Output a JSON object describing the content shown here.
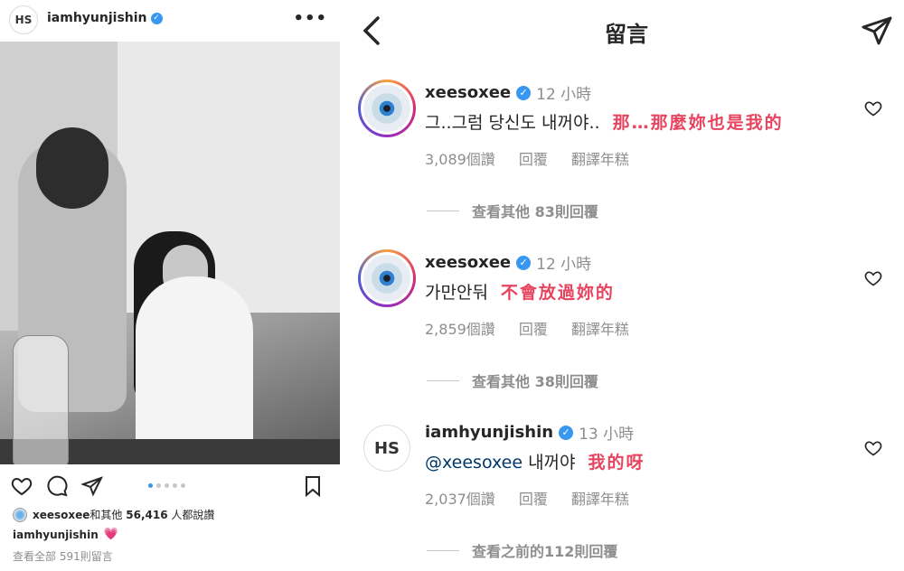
{
  "post": {
    "avatar_initials": "HS",
    "username": "iamhyunjishin",
    "more_label": "•••",
    "carousel_dots": 5,
    "likes_user": "xeesoxee",
    "likes_text": "和其他",
    "likes_count": "56,416",
    "likes_suffix": "人都說讚",
    "caption_user": "iamhyunjishin",
    "caption_emoji": "💗",
    "view_all_comments": "查看全部 591則留言"
  },
  "header": {
    "title": "留言"
  },
  "comments": [
    {
      "username": "xeesoxee",
      "time": "12 小時",
      "text": "그..그럼 당신도 내꺼야..",
      "translation": "那…那麼妳也是我的",
      "likes": "3,089個讚",
      "reply": "回覆",
      "translate": "翻譯年糕",
      "more_replies": "查看其他 83則回覆"
    },
    {
      "username": "xeesoxee",
      "time": "12 小時",
      "text": "가만안둬",
      "translation": "不會放過妳的",
      "likes": "2,859個讚",
      "reply": "回覆",
      "translate": "翻譯年糕",
      "more_replies": "查看其他 38則回覆"
    },
    {
      "avatar_initials": "HS",
      "username": "iamhyunjishin",
      "time": "13 小時",
      "mention": "@xeesoxee",
      "text": "내꺼야",
      "translation": "我的呀",
      "likes": "2,037個讚",
      "reply": "回覆",
      "translate": "翻譯年糕",
      "more_replies": "查看之前的112則回覆"
    }
  ],
  "colors": {
    "verified": "#3897f0",
    "translation": "#e8445f",
    "mention": "#00376b",
    "muted": "#8e8e8e"
  }
}
